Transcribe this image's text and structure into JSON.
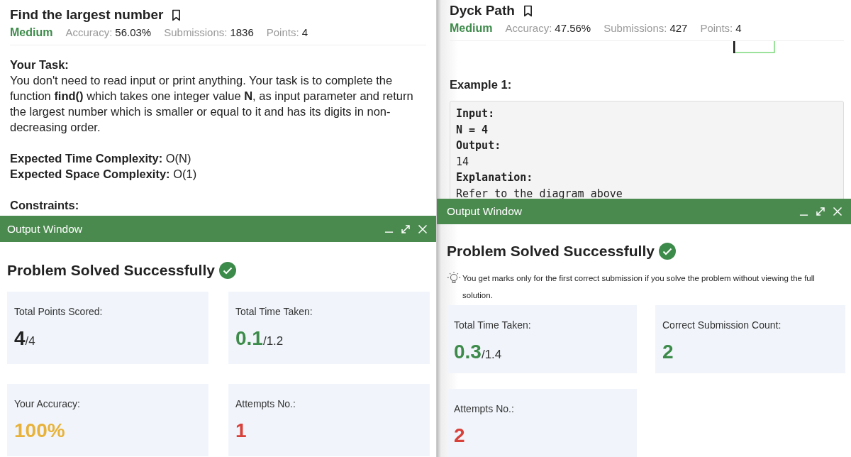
{
  "panels": [
    {
      "title": "Find the largest number",
      "difficulty": "Medium",
      "stats": [
        {
          "label": "Accuracy:",
          "value": "56.03%"
        },
        {
          "label": "Submissions:",
          "value": "1836"
        },
        {
          "label": "Points:",
          "value": "4"
        }
      ],
      "content": [
        {
          "kind": "heading",
          "text": "Your Task:"
        },
        {
          "kind": "paragraph",
          "text": "You don't need to read input or print anything. Your task is to complete the function **find()** which takes one integer value **N**, as input parameter and return the largest number which is smaller or equal to it and has its digits in non-decreasing order."
        },
        {
          "kind": "spacer"
        },
        {
          "kind": "paragraph",
          "text": "**Expected Time Complexity:** O(N)"
        },
        {
          "kind": "paragraph",
          "text": "**Expected Space Complexity:** O(1)"
        },
        {
          "kind": "spacer"
        },
        {
          "kind": "heading",
          "text": "Constraints:"
        }
      ],
      "output": {
        "title": "Output Window",
        "heading": "Problem Solved Successfully",
        "cards": [
          {
            "label": "Total Points Scored:",
            "value": "4",
            "total": "/4",
            "color": "#222222"
          },
          {
            "label": "Total Time Taken:",
            "value": "0.1",
            "total": "/1.2",
            "color": "#3d8b4a"
          },
          {
            "label": "Your Accuracy:",
            "value": "100%",
            "color": "#e8b23a"
          },
          {
            "label": "Attempts No.:",
            "value": "1",
            "color": "#d8403a"
          }
        ]
      }
    },
    {
      "title": "Dyck Path",
      "difficulty": "Medium",
      "stats": [
        {
          "label": "Accuracy:",
          "value": "47.56%"
        },
        {
          "label": "Submissions:",
          "value": "427"
        },
        {
          "label": "Points:",
          "value": "4"
        }
      ],
      "content": [
        {
          "kind": "picture"
        },
        {
          "kind": "heading",
          "text": "Example 1:"
        },
        {
          "kind": "code",
          "lines": [
            {
              "text": "Input:",
              "bold": true
            },
            {
              "text": "N = 4",
              "bold": true
            },
            {
              "text": "Output:",
              "bold": true
            },
            {
              "text": "14",
              "bold": false
            },
            {
              "text": "Explanation:",
              "bold": true
            },
            {
              "text": "Refer to the diagram above",
              "bold": false
            }
          ]
        }
      ],
      "output": {
        "title": "Output Window",
        "heading": "Problem Solved Successfully",
        "note": "You get marks only for the first correct submission if you solve the problem without viewing the full solution.",
        "cards": [
          {
            "label": "Total Time Taken:",
            "value": "0.3",
            "total": "/1.4",
            "color": "#3d8b4a"
          },
          {
            "label": "Correct Submission Count:",
            "value": "2",
            "color": "#3d8b4a"
          },
          {
            "label": "Attempts No.:",
            "value": "2",
            "color": "#d8403a"
          }
        ]
      }
    }
  ]
}
